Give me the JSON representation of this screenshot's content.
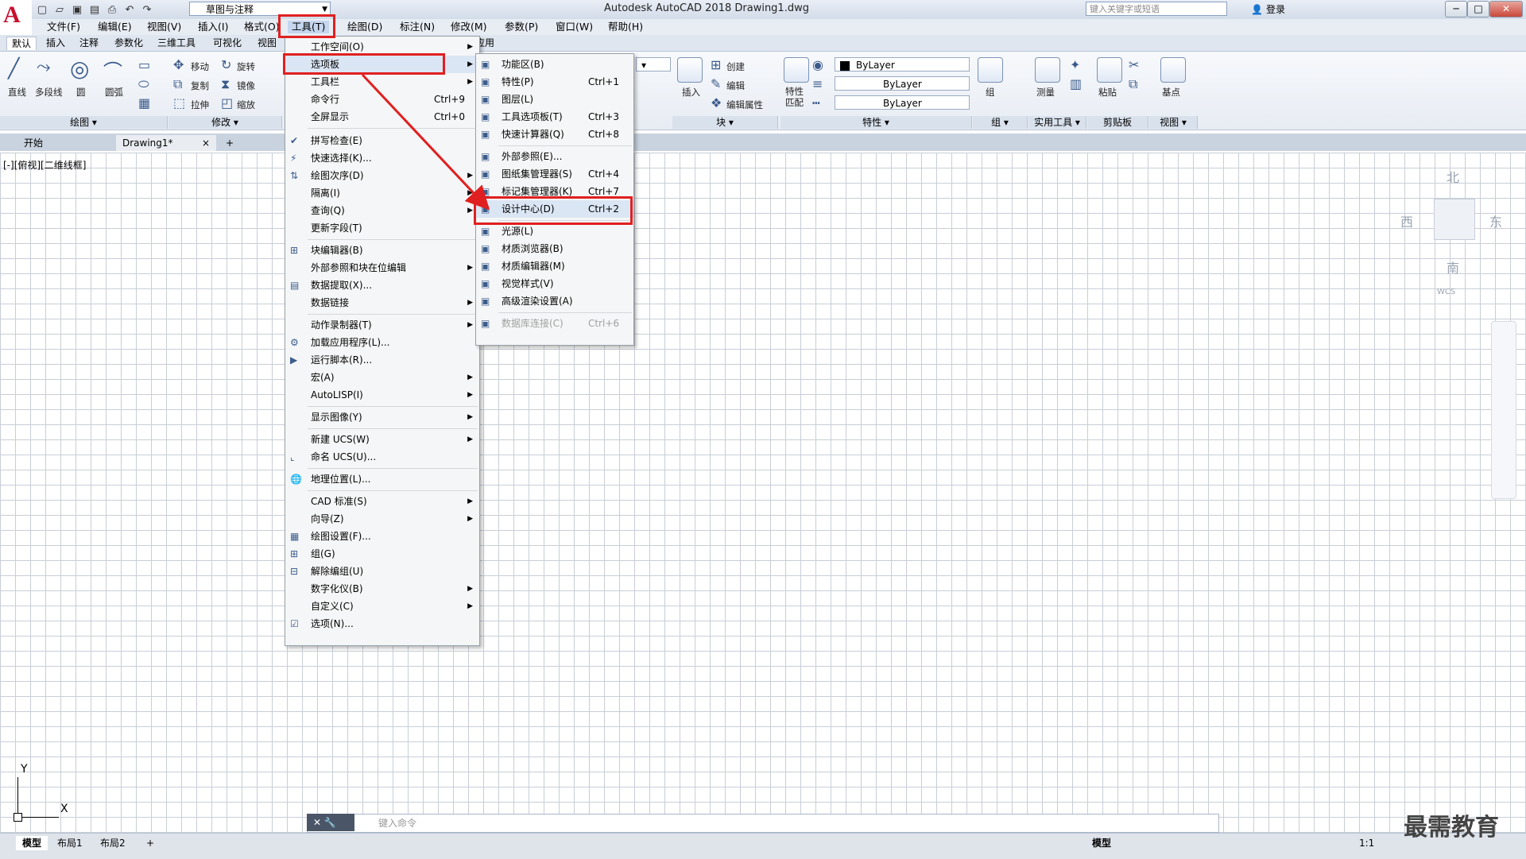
{
  "app": {
    "title": "Autodesk AutoCAD 2018    Drawing1.dwg",
    "workspace": "草图与注释",
    "search_placeholder": "键入关键字或短语",
    "login": "登录"
  },
  "menubar": [
    "文件(F)",
    "编辑(E)",
    "视图(V)",
    "插入(I)",
    "格式(O)",
    "工具(T)",
    "绘图(D)",
    "标注(N)",
    "修改(M)",
    "参数(P)",
    "窗口(W)",
    "帮助(H)"
  ],
  "ribbon_tabs": [
    "默认",
    "插入",
    "注释",
    "参数化",
    "三维工具",
    "可视化",
    "视图",
    "应用"
  ],
  "ribbon": {
    "draw": {
      "line": "直线",
      "polyline": "多段线",
      "circle": "圆",
      "arc": "圆弧",
      "panel": "绘图"
    },
    "modify": {
      "move": "移动",
      "rotate": "旋转",
      "copy": "复制",
      "mirror": "镜像",
      "stretch": "拉伸",
      "scale": "缩放",
      "panel": "修改"
    },
    "block": {
      "insert": "插入",
      "create": "创建",
      "edit": "编辑",
      "edit_attr": "编辑属性",
      "panel": "块"
    },
    "properties": {
      "match": "特性匹配",
      "bylayer1": "ByLayer",
      "bylayer2": "ByLayer",
      "bylayer3": "ByLayer",
      "panel": "特性"
    },
    "group": {
      "label": "组",
      "panel": "组"
    },
    "utilities": {
      "measure": "测量",
      "panel": "实用工具"
    },
    "clipboard": {
      "paste": "粘贴",
      "panel": "剪贴板"
    },
    "view": {
      "base": "基点",
      "panel": "视图"
    }
  },
  "doc_tabs": [
    "开始",
    "Drawing1*"
  ],
  "viewport_label": "[-][俯视][二维线框]",
  "compass": {
    "n": "北",
    "s": "南",
    "e": "东",
    "w": "西",
    "wcs": "WCS"
  },
  "ucs": {
    "x": "X",
    "y": "Y"
  },
  "command_placeholder": "键入命令",
  "layout_tabs": [
    "模型",
    "布局1",
    "布局2"
  ],
  "status": {
    "model": "模型",
    "scale": "1:1"
  },
  "watermark": "最需教育",
  "tools_menu": [
    {
      "label": "工作空间(O)",
      "arrow": true
    },
    {
      "label": "选项板",
      "arrow": true
    },
    {
      "label": "工具栏",
      "arrow": true
    },
    {
      "label": "命令行",
      "shortcut": "Ctrl+9"
    },
    {
      "label": "全屏显示",
      "shortcut": "Ctrl+0"
    },
    {
      "label": "拼写检查(E)"
    },
    {
      "label": "快速选择(K)..."
    },
    {
      "label": "绘图次序(D)",
      "arrow": true
    },
    {
      "label": "隔离(I)",
      "arrow": true
    },
    {
      "label": "查询(Q)",
      "arrow": true
    },
    {
      "label": "更新字段(T)"
    },
    {
      "label": "块编辑器(B)"
    },
    {
      "label": "外部参照和块在位编辑",
      "arrow": true
    },
    {
      "label": "数据提取(X)..."
    },
    {
      "label": "数据链接",
      "arrow": true
    },
    {
      "label": "动作录制器(T)",
      "arrow": true
    },
    {
      "label": "加载应用程序(L)..."
    },
    {
      "label": "运行脚本(R)..."
    },
    {
      "label": "宏(A)",
      "arrow": true
    },
    {
      "label": "AutoLISP(I)",
      "arrow": true
    },
    {
      "label": "显示图像(Y)",
      "arrow": true
    },
    {
      "label": "新建 UCS(W)",
      "arrow": true
    },
    {
      "label": "命名 UCS(U)..."
    },
    {
      "label": "地理位置(L)..."
    },
    {
      "label": "CAD 标准(S)",
      "arrow": true
    },
    {
      "label": "向导(Z)",
      "arrow": true
    },
    {
      "label": "绘图设置(F)..."
    },
    {
      "label": "组(G)"
    },
    {
      "label": "解除编组(U)"
    },
    {
      "label": "数字化仪(B)",
      "arrow": true
    },
    {
      "label": "自定义(C)",
      "arrow": true
    },
    {
      "label": "选项(N)..."
    }
  ],
  "palette_menu": [
    {
      "label": "功能区(B)"
    },
    {
      "label": "特性(P)",
      "shortcut": "Ctrl+1"
    },
    {
      "label": "图层(L)"
    },
    {
      "label": "工具选项板(T)",
      "shortcut": "Ctrl+3"
    },
    {
      "label": "快速计算器(Q)",
      "shortcut": "Ctrl+8"
    },
    {
      "label": "外部参照(E)..."
    },
    {
      "label": "图纸集管理器(S)",
      "shortcut": "Ctrl+4"
    },
    {
      "label": "标记集管理器(K)",
      "shortcut": "Ctrl+7"
    },
    {
      "label": "设计中心(D)",
      "shortcut": "Ctrl+2"
    },
    {
      "label": "光源(L)"
    },
    {
      "label": "材质浏览器(B)"
    },
    {
      "label": "材质编辑器(M)"
    },
    {
      "label": "视觉样式(V)"
    },
    {
      "label": "高级渲染设置(A)"
    },
    {
      "label": "数据库连接(C)",
      "shortcut": "Ctrl+6"
    }
  ]
}
